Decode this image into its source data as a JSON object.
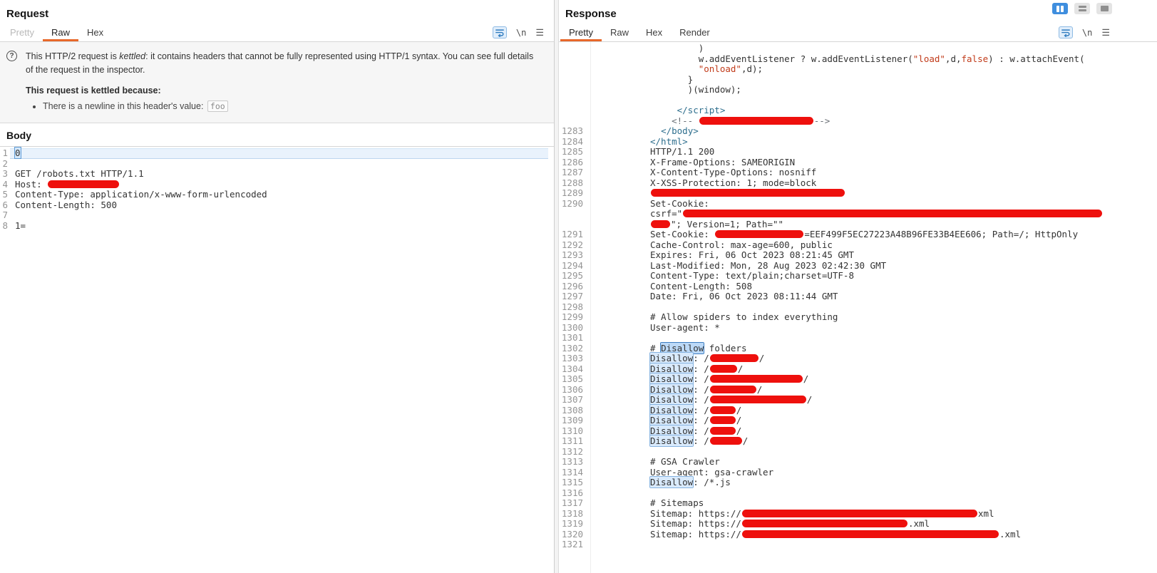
{
  "layout": {
    "buttons": [
      {
        "name": "two-column-layout",
        "icon": "cols",
        "active": true
      },
      {
        "name": "two-row-layout",
        "icon": "rows",
        "active": false
      },
      {
        "name": "single-panel-layout",
        "icon": "single",
        "active": false
      }
    ]
  },
  "request": {
    "title": "Request",
    "tabs": [
      {
        "label": "Pretty",
        "state": "disabled"
      },
      {
        "label": "Raw",
        "state": "active"
      },
      {
        "label": "Hex",
        "state": ""
      }
    ],
    "toolbar": {
      "newline": "\\n",
      "menu": "☰"
    },
    "notice": {
      "icon": "?",
      "intro_pre": "This HTTP/2 request is ",
      "intro_italic": "kettled",
      "intro_post": ": it contains headers that cannot be fully represented using HTTP/1 syntax. You can see full details of the request in the inspector.",
      "reason_title": "This request is kettled because:",
      "reason_item": "There is a newline in this header's value: ",
      "reason_code": "foo"
    },
    "body_title": "Body",
    "lines": [
      {
        "n": "1",
        "cls": "current",
        "seg": [
          {
            "t": "0",
            "c": "caret"
          }
        ]
      },
      {
        "n": "2",
        "seg": []
      },
      {
        "n": "3",
        "seg": [
          {
            "t": "GET /robots.txt HTTP/1.1"
          }
        ]
      },
      {
        "n": "4",
        "seg": [
          {
            "t": "Host: "
          },
          {
            "r": 100
          }
        ]
      },
      {
        "n": "5",
        "seg": [
          {
            "t": "Content-Type: application/x-www-form-urlencoded"
          }
        ]
      },
      {
        "n": "6",
        "seg": [
          {
            "t": "Content-Length: 500"
          }
        ]
      },
      {
        "n": "7",
        "seg": []
      },
      {
        "n": "8",
        "seg": [
          {
            "t": "1="
          }
        ]
      }
    ]
  },
  "response": {
    "title": "Response",
    "tabs": [
      {
        "label": "Pretty",
        "state": "active"
      },
      {
        "label": "Raw",
        "state": ""
      },
      {
        "label": "Hex",
        "state": ""
      },
      {
        "label": "Render",
        "state": ""
      }
    ],
    "toolbar": {
      "newline": "\\n",
      "menu": "☰"
    },
    "lines": [
      {
        "n": "",
        "seg": [
          {
            "t": "         )"
          }
        ]
      },
      {
        "n": "",
        "seg": [
          {
            "t": "         w.addEventListener ? w.addEventListener("
          },
          {
            "t": "\"load\"",
            "c": "str"
          },
          {
            "t": ",d,"
          },
          {
            "t": "false",
            "c": "str"
          },
          {
            "t": ") : w.attachEvent("
          }
        ]
      },
      {
        "n": "",
        "seg": [
          {
            "t": "         "
          },
          {
            "t": "\"onload\"",
            "c": "str"
          },
          {
            "t": ",d);"
          }
        ]
      },
      {
        "n": "",
        "seg": [
          {
            "t": "       }"
          }
        ]
      },
      {
        "n": "",
        "seg": [
          {
            "t": "       )(window);"
          }
        ]
      },
      {
        "n": "",
        "seg": []
      },
      {
        "n": "",
        "seg": [
          {
            "t": "     </script>",
            "c": "tag"
          }
        ]
      },
      {
        "n": "",
        "seg": [
          {
            "t": "    <!-- ",
            "c": "com"
          },
          {
            "r": 160
          },
          {
            "t": "-->",
            "c": "com"
          }
        ]
      },
      {
        "n": "1283",
        "seg": [
          {
            "t": "  "
          },
          {
            "t": "</body>",
            "c": "tag"
          }
        ]
      },
      {
        "n": "1284",
        "seg": [
          {
            "t": "</html>",
            "c": "tag"
          }
        ]
      },
      {
        "n": "1285",
        "seg": [
          {
            "t": "HTTP/1.1 200"
          }
        ]
      },
      {
        "n": "1286",
        "seg": [
          {
            "t": "X-Frame-Options: SAMEORIGIN"
          }
        ]
      },
      {
        "n": "1287",
        "seg": [
          {
            "t": "X-Content-Type-Options: nosniff"
          }
        ]
      },
      {
        "n": "1288",
        "seg": [
          {
            "t": "X-XSS-Protection: 1; mode=block"
          }
        ]
      },
      {
        "n": "1289",
        "seg": [
          {
            "r": 272
          }
        ]
      },
      {
        "n": "1290",
        "seg": [
          {
            "t": "Set-Cookie:"
          }
        ]
      },
      {
        "n": "",
        "seg": [
          {
            "t": "csrf=\""
          },
          {
            "r": 588
          }
        ]
      },
      {
        "n": "",
        "seg": [
          {
            "r": 27
          },
          {
            "t": "\"; Version=1; Path=\"\""
          }
        ]
      },
      {
        "n": "1291",
        "seg": [
          {
            "t": "Set-Cookie: "
          },
          {
            "r": 124
          },
          {
            "t": "=EEF499F5EC27223A48B96FE33B4EE606; Path=/; HttpOnly"
          }
        ]
      },
      {
        "n": "1292",
        "seg": [
          {
            "t": "Cache-Control: max-age=600, public"
          }
        ]
      },
      {
        "n": "1293",
        "seg": [
          {
            "t": "Expires: Fri, 06 Oct 2023 08:21:45 GMT"
          }
        ]
      },
      {
        "n": "1294",
        "seg": [
          {
            "t": "Last-Modified: Mon, 28 Aug 2023 02:42:30 GMT"
          }
        ]
      },
      {
        "n": "1295",
        "seg": [
          {
            "t": "Content-Type: text/plain;charset=UTF-8"
          }
        ]
      },
      {
        "n": "1296",
        "seg": [
          {
            "t": "Content-Length: 508"
          }
        ]
      },
      {
        "n": "1297",
        "seg": [
          {
            "t": "Date: Fri, 06 Oct 2023 08:11:44 GMT"
          }
        ]
      },
      {
        "n": "1298",
        "seg": []
      },
      {
        "n": "1299",
        "seg": [
          {
            "t": "# Allow spiders to index everything"
          }
        ]
      },
      {
        "n": "1300",
        "seg": [
          {
            "t": "User-agent: *"
          }
        ]
      },
      {
        "n": "1301",
        "seg": []
      },
      {
        "n": "1302",
        "seg": [
          {
            "t": "# "
          },
          {
            "t": "Disallow",
            "c": "sel"
          },
          {
            "t": " folders"
          }
        ]
      },
      {
        "n": "1303",
        "seg": [
          {
            "t": "Disallow",
            "c": "hl"
          },
          {
            "t": ": /"
          },
          {
            "r": 68
          },
          {
            "t": "/"
          }
        ]
      },
      {
        "n": "1304",
        "seg": [
          {
            "t": "Disallow",
            "c": "hl"
          },
          {
            "t": ": /"
          },
          {
            "r": 38
          },
          {
            "t": "/"
          }
        ]
      },
      {
        "n": "1305",
        "seg": [
          {
            "t": "Disallow",
            "c": "hl"
          },
          {
            "t": ": /"
          },
          {
            "r": 130
          },
          {
            "t": "/"
          }
        ]
      },
      {
        "n": "1306",
        "seg": [
          {
            "t": "Disallow",
            "c": "hl"
          },
          {
            "t": ": /"
          },
          {
            "r": 65
          },
          {
            "t": "/"
          }
        ]
      },
      {
        "n": "1307",
        "seg": [
          {
            "t": "Disallow",
            "c": "hl"
          },
          {
            "t": ": /"
          },
          {
            "r": 135
          },
          {
            "t": "/"
          }
        ]
      },
      {
        "n": "1308",
        "seg": [
          {
            "t": "Disallow",
            "c": "hl"
          },
          {
            "t": ": /"
          },
          {
            "r": 36
          },
          {
            "t": "/"
          }
        ]
      },
      {
        "n": "1309",
        "seg": [
          {
            "t": "Disallow",
            "c": "hl"
          },
          {
            "t": ": /"
          },
          {
            "r": 36
          },
          {
            "t": "/"
          }
        ]
      },
      {
        "n": "1310",
        "seg": [
          {
            "t": "Disallow",
            "c": "hl"
          },
          {
            "t": ": /"
          },
          {
            "r": 36
          },
          {
            "t": "/"
          }
        ]
      },
      {
        "n": "1311",
        "seg": [
          {
            "t": "Disallow",
            "c": "hl"
          },
          {
            "t": ": /"
          },
          {
            "r": 45
          },
          {
            "t": "/"
          }
        ]
      },
      {
        "n": "1312",
        "seg": []
      },
      {
        "n": "1313",
        "seg": [
          {
            "t": "# GSA Crawler"
          }
        ]
      },
      {
        "n": "1314",
        "seg": [
          {
            "t": "User-agent: gsa-crawler"
          }
        ]
      },
      {
        "n": "1315",
        "seg": [
          {
            "t": "Disallow",
            "c": "hl"
          },
          {
            "t": ": /*.js"
          }
        ]
      },
      {
        "n": "1316",
        "seg": []
      },
      {
        "n": "1317",
        "seg": [
          {
            "t": "# Sitemaps"
          }
        ]
      },
      {
        "n": "1318",
        "seg": [
          {
            "t": "Sitemap: https://"
          },
          {
            "r": 330
          },
          {
            "t": "xml"
          }
        ]
      },
      {
        "n": "1319",
        "seg": [
          {
            "t": "Sitemap: https://"
          },
          {
            "r": 232
          },
          {
            "t": ".xml"
          }
        ]
      },
      {
        "n": "1320",
        "seg": [
          {
            "t": "Sitemap: https://"
          },
          {
            "r": 360
          },
          {
            "t": ".xml"
          }
        ]
      },
      {
        "n": "1321",
        "seg": []
      }
    ]
  }
}
